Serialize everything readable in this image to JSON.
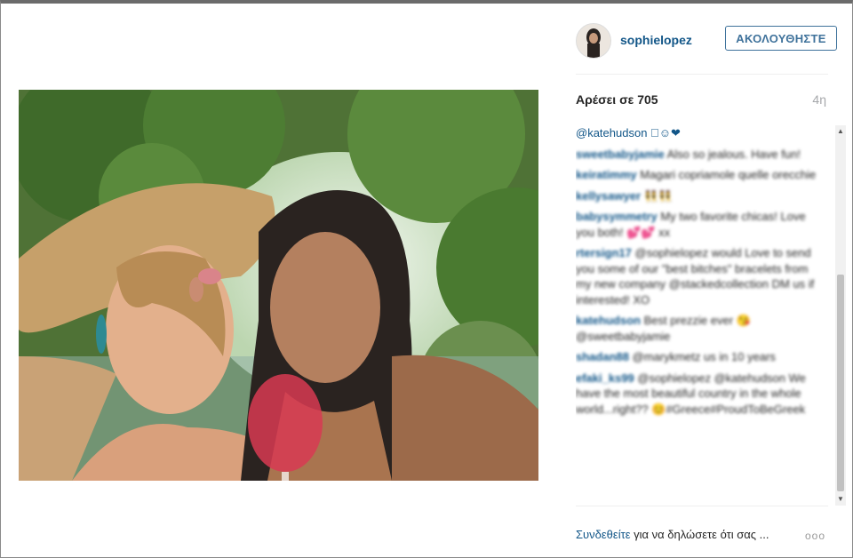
{
  "post": {
    "username": "sophielopez",
    "follow_label": "ΑΚΟΛΟΥΘΗΣΤΕ",
    "likes_text": "Αρέσει σε 705",
    "time_ago": "4η"
  },
  "comments": [
    {
      "user": "",
      "text": "@katehudson 🏻☺❤",
      "blurred": false
    },
    {
      "user": "sweetbabyjamie",
      "text": "Also so jealous. Have fun!",
      "blurred": true
    },
    {
      "user": "keiratimmy",
      "text": "Magari copriamole quelle orecchie",
      "blurred": true
    },
    {
      "user": "kellysawyer",
      "text": "👯👯",
      "blurred": true
    },
    {
      "user": "babysymmetry",
      "text": "My two favorite chicas! Love you both! 💕💕 xx",
      "blurred": true
    },
    {
      "user": "rtersign17",
      "text": "@sophielopez would Love to send you some of our \"best bitches\" bracelets from my new company @stackedcollection DM us if interested! XO",
      "blurred": true
    },
    {
      "user": "katehudson",
      "text": "Best prezzie ever 😘 @sweetbabyjamie",
      "blurred": true
    },
    {
      "user": "shadan88",
      "text": "@marykmetz us in 10 years",
      "blurred": true
    },
    {
      "user": "efaki_ks99",
      "text": "@sophielopez @katehudson We have the most beautiful country in the whole world...right?? 😊#Greece#ProudToBeGreek",
      "blurred": true
    }
  ],
  "footer": {
    "login_link": "Συνδεθείτε",
    "login_rest": " για να δηλώσετε ότι σας ...",
    "more_label": "ooo"
  },
  "colors": {
    "link": "#125688",
    "follow_border": "#3f729b"
  }
}
